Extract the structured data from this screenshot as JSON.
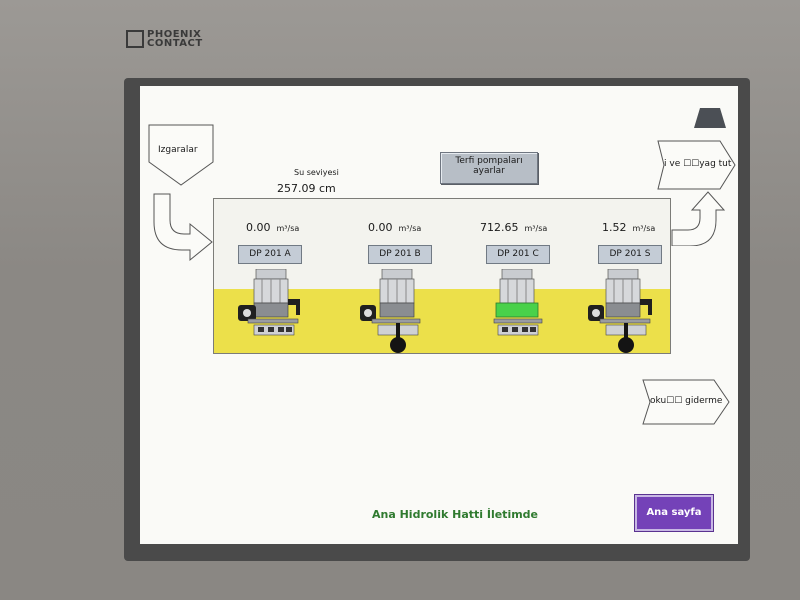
{
  "device": {
    "brand_line1": "PHOENIX",
    "brand_line2": "CONTACT"
  },
  "left_panel": {
    "screens_label": "Izgaralar"
  },
  "level": {
    "label": "Su seviyesi",
    "value": "257.09 cm"
  },
  "booster_button": {
    "line1": "Terfi pompaları",
    "line2": "ayarlar"
  },
  "right_nav": {
    "top_label": "i ve ☐☐yag tut",
    "bottom_label": "oku☐☐ giderme"
  },
  "pumps": [
    {
      "id": "DP 201 A",
      "flow": "0.00",
      "unit": "m³/sa",
      "running": false
    },
    {
      "id": "DP 201 B",
      "flow": "0.00",
      "unit": "m³/sa",
      "running": false
    },
    {
      "id": "DP 201 C",
      "flow": "712.65",
      "unit": "m³/sa",
      "running": true
    },
    {
      "id": "DP 201 S",
      "flow": "1.52",
      "unit": "m³/sa",
      "running": false
    }
  ],
  "status": {
    "text": "Ana Hidrolik Hatti İletimde"
  },
  "home_button": {
    "label": "Ana sayfa"
  },
  "colors": {
    "running": "#49d14a",
    "stopped": "#8a8d91",
    "basin": "#ece04a",
    "status_text": "#2f7a2f",
    "home_button": "#7442b8"
  }
}
